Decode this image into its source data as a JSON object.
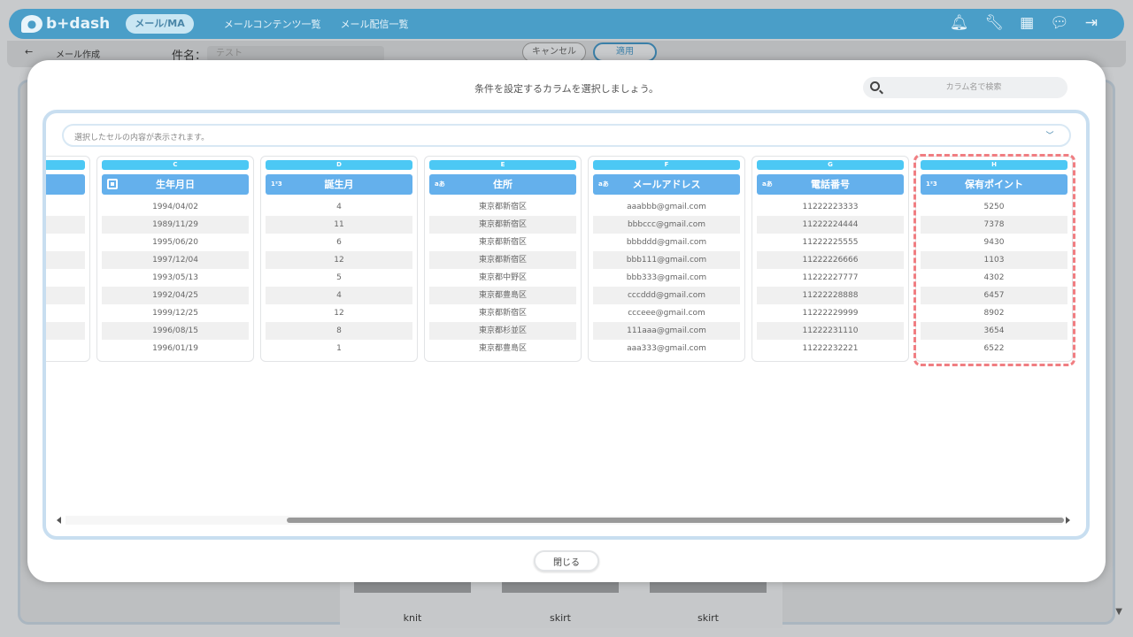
{
  "app": {
    "logo_text": "b+dash",
    "mode": "メール/MA",
    "nav": [
      "メールコンテンツ一覧",
      "メール配信一覧"
    ]
  },
  "subbar": {
    "back_icon": "←",
    "crumb": "メール作成",
    "subject_label": "件名：",
    "subject_value": "テスト",
    "cancel_label": "キャンセル",
    "apply_label": "適用"
  },
  "products": [
    "knit",
    "skirt",
    "skirt"
  ],
  "modal": {
    "instruction": "条件を設定するカラムを選択しましょう。",
    "search_placeholder": "カラム名で検索",
    "cell_preview_placeholder": "選択したセルの内容が表示されます。",
    "close_label": "閉じる"
  },
  "columns": [
    {
      "letter": "C",
      "name": "生年月日",
      "type_icon": "calendar-icon",
      "values": [
        "1994/04/02",
        "1989/11/29",
        "1995/06/20",
        "1997/12/04",
        "1993/05/13",
        "1992/04/25",
        "1999/12/25",
        "1996/08/15",
        "1996/01/19"
      ]
    },
    {
      "letter": "D",
      "name": "誕生月",
      "type_icon": "number-icon",
      "type_glyph": "1²3",
      "values": [
        "4",
        "11",
        "6",
        "12",
        "5",
        "4",
        "12",
        "8",
        "1"
      ]
    },
    {
      "letter": "E",
      "name": "住所",
      "type_icon": "text-icon",
      "type_glyph": "aあ",
      "values": [
        "東京都新宿区",
        "東京都新宿区",
        "東京都新宿区",
        "東京都新宿区",
        "東京都中野区",
        "東京都豊島区",
        "東京都新宿区",
        "東京都杉並区",
        "東京都豊島区"
      ]
    },
    {
      "letter": "F",
      "name": "メールアドレス",
      "type_icon": "text-icon",
      "type_glyph": "aあ",
      "values": [
        "aaabbb@gmail.com",
        "bbbccc@gmail.com",
        "bbbddd@gmail.com",
        "bbb111@gmail.com",
        "bbb333@gmail.com",
        "cccddd@gmail.com",
        "ccceee@gmail.com",
        "111aaa@gmail.com",
        "aaa333@gmail.com"
      ]
    },
    {
      "letter": "G",
      "name": "電話番号",
      "type_icon": "text-icon",
      "type_glyph": "aあ",
      "values": [
        "11222223333",
        "11222224444",
        "11222225555",
        "11222226666",
        "11222227777",
        "11222228888",
        "11222229999",
        "11222231110",
        "11222232221"
      ]
    },
    {
      "letter": "H",
      "name": "保有ポイント",
      "type_icon": "number-icon",
      "type_glyph": "1²3",
      "values": [
        "5250",
        "7378",
        "9430",
        "1103",
        "4302",
        "6457",
        "8902",
        "3654",
        "6522"
      ]
    }
  ],
  "colors": {
    "accent": "#64b0ec",
    "letter_bar": "#4cc8f4",
    "highlight": "#f07e82"
  }
}
